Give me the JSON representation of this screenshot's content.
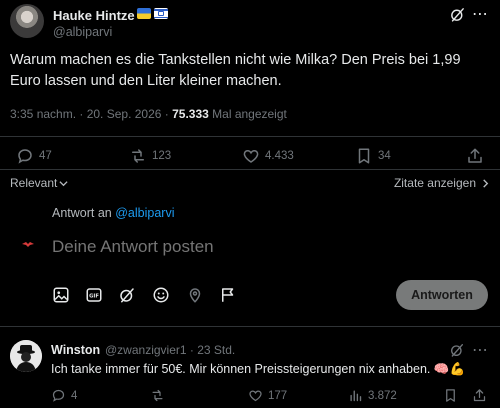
{
  "post": {
    "author_name": "Hauke Hintze",
    "author_handle": "@albiparvi",
    "text": "Warum machen es die Tankstellen nicht wie Milka? Den Preis bei 1,99 Euro lassen und den Liter kleiner machen.",
    "time": "3:35 nachm. · 20. Sep. 2026 · ",
    "views": "75.333",
    "views_label": " Mal angezeigt",
    "flags": [
      "ukraine-flag",
      "israel-flag"
    ]
  },
  "actions": {
    "replies": "47",
    "reposts": "123",
    "likes": "4.433",
    "bookmarks": "34"
  },
  "sort": {
    "label": "Relevant",
    "quotes_label": "Zitate anzeigen"
  },
  "composer": {
    "reply_to_prefix": "Antwort an ",
    "reply_to_handle": "@albiparvi",
    "placeholder": "Deine Antwort posten",
    "submit_label": "Antworten",
    "tools": [
      "image-icon",
      "gif-icon",
      "grok-icon",
      "emoji-icon",
      "location-icon",
      "flag-icon"
    ]
  },
  "comment": {
    "author_name": "Winston",
    "author_handle": "@zwanzigvier1 · 23 Std.",
    "text": "Ich tanke immer für 50€. Mir können Preissteigerungen nix anhaben.",
    "emoji": "🧠💪",
    "replies": "4",
    "reposts": "",
    "likes": "177",
    "views": "3.872"
  },
  "colors": {
    "background": "#000000",
    "text": "#e7e9ea",
    "muted": "#71767b",
    "link": "#1d9bf0",
    "button": "#787a7a"
  }
}
